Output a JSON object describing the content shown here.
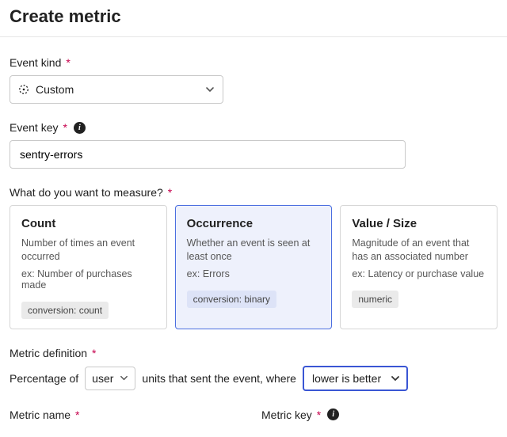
{
  "title": "Create metric",
  "event_kind": {
    "label": "Event kind",
    "value": "Custom"
  },
  "event_key": {
    "label": "Event key",
    "value": "sentry-errors"
  },
  "measure": {
    "label": "What do you want to measure?",
    "options": [
      {
        "title": "Count",
        "desc": "Number of times an event occurred",
        "example": "ex: Number of purchases made",
        "tag": "conversion: count",
        "selected": false
      },
      {
        "title": "Occurrence",
        "desc": "Whether an event is seen at least once",
        "example": "ex: Errors",
        "tag": "conversion: binary",
        "selected": true
      },
      {
        "title": "Value / Size",
        "desc": "Magnitude of an event that has an associated number",
        "example": "ex: Latency or purchase value",
        "tag": "numeric",
        "selected": false
      }
    ]
  },
  "definition": {
    "label": "Metric definition",
    "prefix": "Percentage of",
    "unit": "user",
    "mid": "units that sent the event, where",
    "criteria": "lower is better"
  },
  "metric_name": {
    "label": "Metric name"
  },
  "metric_key": {
    "label": "Metric key"
  }
}
